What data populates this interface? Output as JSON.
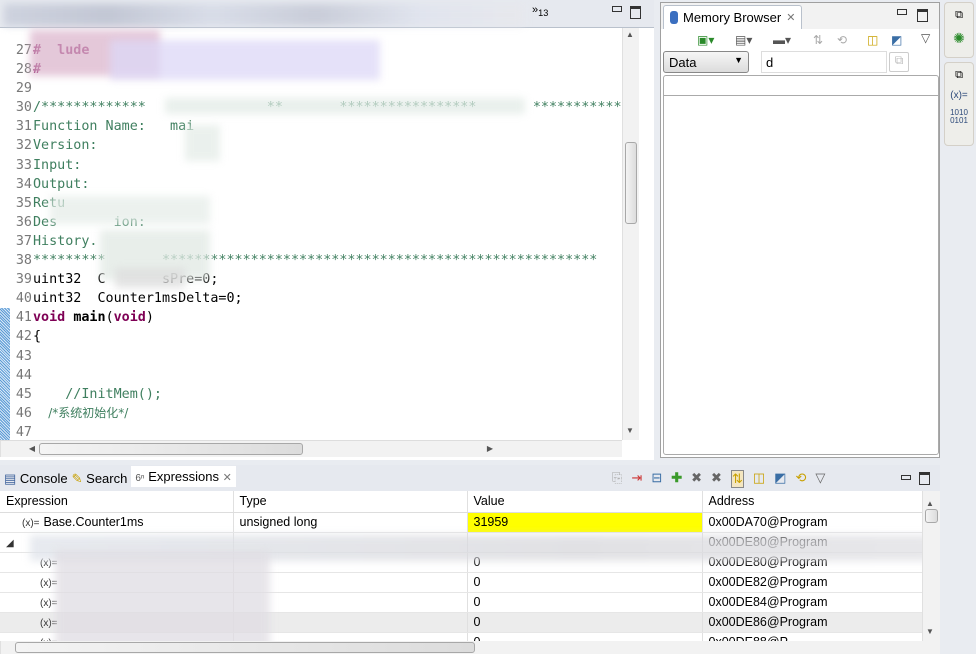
{
  "editor": {
    "overflow_tabs": "»",
    "overflow_count": "13",
    "lines": [
      {
        "n": "27",
        "parts": [
          {
            "t": "#",
            "c": "kw"
          },
          {
            "t": "  lude",
            "c": "kw"
          }
        ]
      },
      {
        "n": "28",
        "parts": [
          {
            "t": "#",
            "c": "kw"
          }
        ]
      },
      {
        "n": "29",
        "parts": []
      },
      {
        "n": "30",
        "parts": [
          {
            "t": "/*************               **       *****************       ***********",
            "c": "cm"
          }
        ]
      },
      {
        "n": "31",
        "parts": [
          {
            "t": "Function Name:   mai",
            "c": "cm"
          }
        ]
      },
      {
        "n": "32",
        "parts": [
          {
            "t": "Version:",
            "c": "cm"
          }
        ]
      },
      {
        "n": "33",
        "parts": [
          {
            "t": "Input:",
            "c": "cm"
          }
        ]
      },
      {
        "n": "34",
        "parts": [
          {
            "t": "Output:",
            "c": "cm"
          }
        ]
      },
      {
        "n": "35",
        "parts": [
          {
            "t": "Retu",
            "c": "cm"
          }
        ]
      },
      {
        "n": "36",
        "parts": [
          {
            "t": "Des       ion:",
            "c": "cm"
          }
        ]
      },
      {
        "n": "37",
        "parts": [
          {
            "t": "History.",
            "c": "cm"
          }
        ]
      },
      {
        "n": "38",
        "parts": [
          {
            "t": "*********       ******************************************************",
            "c": "cm"
          }
        ]
      },
      {
        "n": "39",
        "parts": [
          {
            "t": "uint32  C       sPre=0;",
            "c": ""
          }
        ]
      },
      {
        "n": "40",
        "parts": [
          {
            "t": "uint32  Counter1msDelta=0;",
            "c": ""
          }
        ]
      },
      {
        "n": "41",
        "parts": [
          {
            "t": "void",
            "c": "kw"
          },
          {
            "t": " ",
            "c": ""
          },
          {
            "t": "main",
            "c": "b"
          },
          {
            "t": "(",
            "c": ""
          },
          {
            "t": "void",
            "c": "kw"
          },
          {
            "t": ")",
            "c": ""
          }
        ]
      },
      {
        "n": "42",
        "parts": [
          {
            "t": "{",
            "c": ""
          }
        ]
      },
      {
        "n": "43",
        "parts": []
      },
      {
        "n": "44",
        "parts": []
      },
      {
        "n": "45",
        "parts": [
          {
            "t": "    //InitMem();",
            "c": "cm"
          }
        ]
      },
      {
        "n": "46",
        "parts": [
          {
            "t": "    /*系统初始化*/",
            "c": "cm cjk"
          }
        ]
      },
      {
        "n": "47",
        "parts": []
      }
    ]
  },
  "memory_browser": {
    "title": "Memory Browser",
    "memory_space": "Data",
    "address_input": "d"
  },
  "trim": {
    "variables_label": "(x)=",
    "memory_label_1": "1010",
    "memory_label_2": "0101"
  },
  "bottom": {
    "tabs": [
      {
        "label": "Console"
      },
      {
        "label": "Search"
      },
      {
        "label": "Expressions",
        "active": true
      }
    ],
    "columns": [
      "Expression",
      "Type",
      "Value",
      "Address"
    ],
    "rows": [
      {
        "expr": "Base.Counter1ms",
        "type": "unsigned long",
        "value": "31959",
        "address": "0x00DA70@Program",
        "highlight": true
      },
      {
        "expr": "",
        "type": "",
        "value": "",
        "address": "0x00DE80@Program"
      },
      {
        "expr": "",
        "type": "",
        "value": "0",
        "address": "0x00DE80@Program"
      },
      {
        "expr": "",
        "type": "",
        "value": "0",
        "address": "0x00DE82@Program"
      },
      {
        "expr": "",
        "type": "",
        "value": "0",
        "address": "0x00DE84@Program"
      },
      {
        "expr": "",
        "type": "",
        "value": "0",
        "address": "0x00DE86@Program",
        "selected": true
      },
      {
        "expr": "",
        "type": "",
        "value": "0",
        "address": "0x00DE88@P"
      }
    ],
    "highlight_color": "#ffff00"
  }
}
